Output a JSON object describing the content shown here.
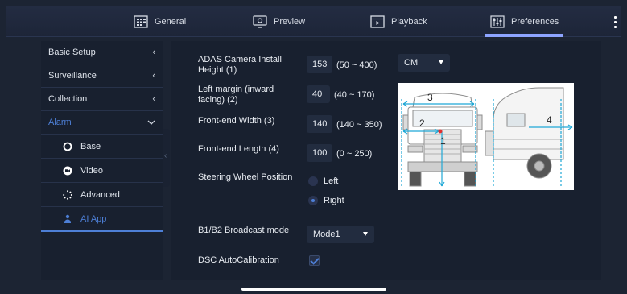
{
  "tabs": [
    {
      "label": "General",
      "icon": "grid-icon"
    },
    {
      "label": "Preview",
      "icon": "monitor-icon"
    },
    {
      "label": "Playback",
      "icon": "playback-icon"
    },
    {
      "label": "Preferences",
      "icon": "sliders-icon"
    }
  ],
  "active_tab": "Preferences",
  "sidebar": {
    "items": [
      {
        "label": "Basic Setup",
        "chevron": "<"
      },
      {
        "label": "Surveillance",
        "chevron": "<"
      },
      {
        "label": "Collection",
        "chevron": "<"
      },
      {
        "label": "Alarm",
        "chevron": "v"
      }
    ],
    "sub_items": [
      {
        "label": "Base",
        "icon": "circle-icon"
      },
      {
        "label": "Video",
        "icon": "video-icon"
      },
      {
        "label": "Advanced",
        "icon": "spinner-icon"
      },
      {
        "label": "AI App",
        "icon": "people-icon"
      }
    ]
  },
  "form": {
    "camera_height": {
      "label": "ADAS Camera Install Height (1)",
      "value": "153",
      "range": "(50 ~ 400)"
    },
    "unit": {
      "value": "CM"
    },
    "left_margin": {
      "label": "Left margin (inward facing) (2)",
      "value": "40",
      "range": "(40 ~ 170)"
    },
    "front_width": {
      "label": "Front-end Width (3)",
      "value": "140",
      "range": "(140 ~ 350)"
    },
    "front_length": {
      "label": "Front-end Length (4)",
      "value": "100",
      "range": "(0 ~ 250)"
    },
    "steering": {
      "label": "Steering Wheel Position",
      "options": [
        "Left",
        "Right"
      ],
      "selected": "Right"
    },
    "broadcast": {
      "label": "B1/B2 Broadcast mode",
      "value": "Mode1"
    },
    "dsc": {
      "label": "DSC AutoCalibration",
      "checked": true
    }
  },
  "diagram": {
    "labels": [
      "1",
      "2",
      "3",
      "4"
    ]
  },
  "colors": {
    "accent": "#4d7fd6",
    "tab_indicator": "#8da4ff",
    "background": "#1c2433"
  }
}
